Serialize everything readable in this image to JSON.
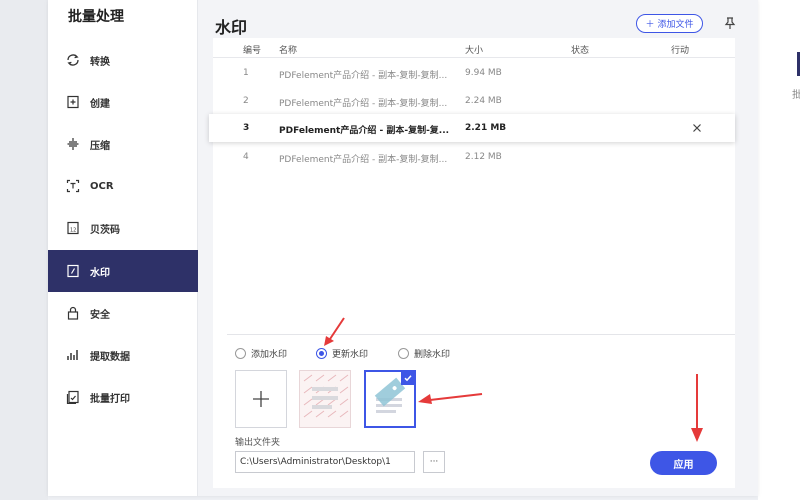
{
  "colors": {
    "accent": "#3e56e6",
    "sidebar_active": "#2e3168",
    "annotation_arrow": "#e53a3a"
  },
  "sidebar": {
    "title": "批量处理",
    "items": [
      {
        "label": "转换",
        "icon": "convert-icon"
      },
      {
        "label": "创建",
        "icon": "create-icon"
      },
      {
        "label": "压缩",
        "icon": "compress-icon"
      },
      {
        "label": "OCR",
        "icon": "ocr-icon"
      },
      {
        "label": "贝茨码",
        "icon": "bates-icon"
      },
      {
        "label": "水印",
        "icon": "watermark-icon",
        "active": true
      },
      {
        "label": "安全",
        "icon": "lock-icon"
      },
      {
        "label": "提取数据",
        "icon": "chart-icon"
      },
      {
        "label": "批量打印",
        "icon": "print-icon"
      }
    ]
  },
  "main": {
    "title": "水印",
    "add_file_label": "添加文件",
    "table": {
      "headers": {
        "index": "编号",
        "name": "名称",
        "size": "大小",
        "status": "状态",
        "action": "行动"
      },
      "rows": [
        {
          "index": "1",
          "name": "PDFelement产品介绍 - 副本-复制-复制...",
          "size": "9.94 MB"
        },
        {
          "index": "2",
          "name": "PDFelement产品介绍 - 副本-复制-复制...",
          "size": "2.24 MB"
        },
        {
          "index": "3",
          "name": "PDFelement产品介绍 - 副本-复制-复...",
          "size": "2.21 MB",
          "selected": true
        },
        {
          "index": "4",
          "name": "PDFelement产品介绍 - 副本-复制-复制...",
          "size": "2.12 MB"
        }
      ]
    },
    "options": {
      "add": "添加水印",
      "update": "更新水印",
      "remove": "删除水印",
      "selected": "update"
    },
    "output_label": "输出文件夹",
    "output_path": "C:\\Users\\Administrator\\Desktop\\1",
    "browse_label": "···",
    "apply_label": "应用"
  }
}
